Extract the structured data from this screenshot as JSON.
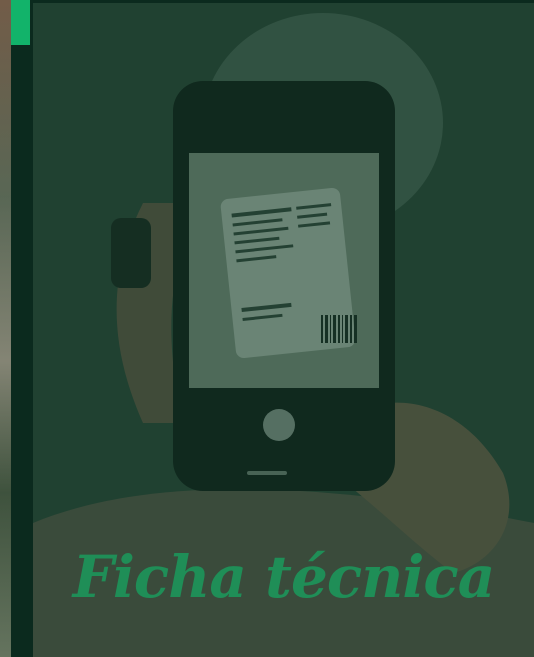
{
  "hero": {
    "title": "Ficha técnica",
    "image_description_icon": "phone-scanning-product-image"
  },
  "colors": {
    "accent": "#12b36a",
    "title": "#1f8e57",
    "dark_green": "#0b2a1e",
    "overlay": "rgba(16,58,40,0.55)"
  }
}
